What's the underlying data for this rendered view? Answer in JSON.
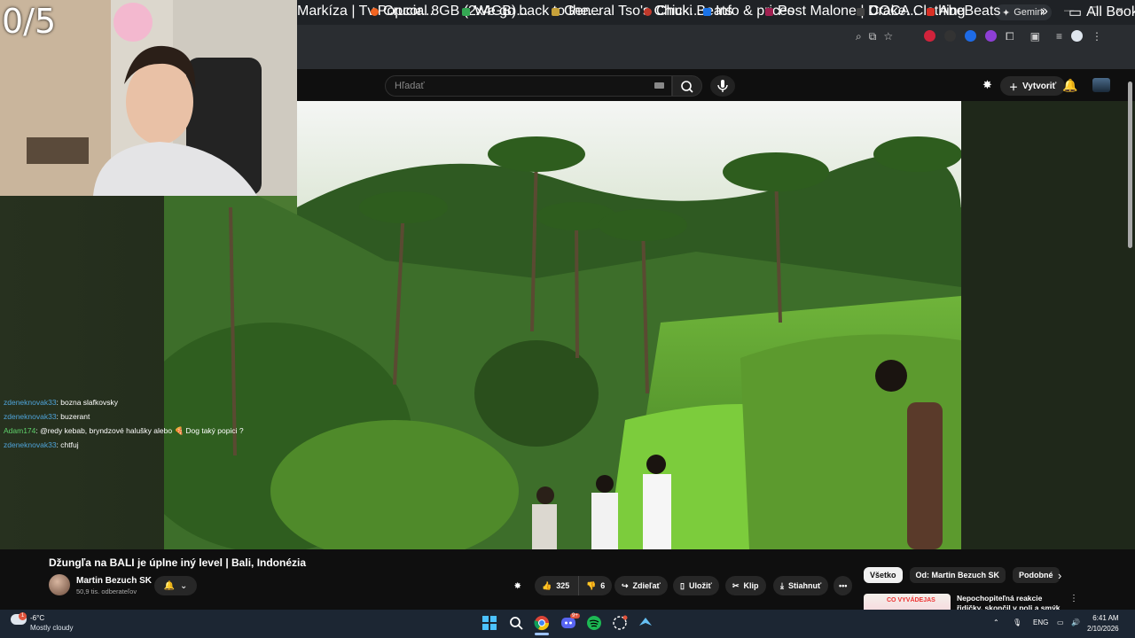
{
  "stream_overlay": {
    "counter": "0/5",
    "chat": [
      {
        "user": "zdeneknovak33",
        "message": ": bozna slafkovsky",
        "user_color": "#4ea3d9"
      },
      {
        "user": "zdeneknovak33",
        "message": ": buzerant",
        "user_color": "#4ea3d9"
      },
      {
        "user": "Adam174",
        "message": ": @redy kebab, bryndzové halušky alebo 🍕 Dog taký popici ?",
        "user_color": "#5fd16b"
      },
      {
        "user": "zdeneknovak33",
        "message": ": chtfuj",
        "user_color": "#4ea3d9"
      }
    ]
  },
  "browser": {
    "gemini_label": "Gemini",
    "bookmarks": [
      {
        "label": "Markíza | Tv.Popcor...",
        "color": "#3a7bd5"
      },
      {
        "label": "Crucial 8GB (2x4GB)...",
        "color": "#f26522"
      },
      {
        "label": "We go back to the...",
        "color": "#34a853"
      },
      {
        "label": "General Tso's Chick...",
        "color": "#c7a13a"
      },
      {
        "label": "Chuki Beats",
        "color": "#c0392b"
      },
      {
        "label": "Info & prices",
        "color": "#1a73e8"
      },
      {
        "label": "Post Malone | Drake...",
        "color": "#a02050"
      },
      {
        "label": "COCA Clothing",
        "color": "#222222"
      },
      {
        "label": "AbeBeats",
        "color": "#d93025"
      }
    ],
    "more_bookmarks": "»",
    "all_bookmarks": "All Bookmarks"
  },
  "youtube": {
    "search_placeholder": "Hľadať",
    "create_label": "Vytvoriť",
    "video_title": "Džungľa na BALI je úplne iný level | Bali, Indonézia",
    "channel_name": "Martin Bezuch SK",
    "subscribers": "50,9 tis. odberateľov",
    "likes": "325",
    "dislikes": "6",
    "share_label": "Zdieľať",
    "save_label": "Uložiť",
    "clip_label": "Klip",
    "download_label": "Stiahnuť",
    "more_label": "•••",
    "chips": [
      "Všetko",
      "Od: Martin Bezuch SK",
      "Podobné"
    ],
    "recommended": {
      "thumb_text": "CO VYVÁDEJAS",
      "title": "Nepochopiteľná reakcie řidičky, skončil v poli a smýk na ledov..."
    }
  },
  "taskbar": {
    "weather_badge": "1",
    "temperature": "-6°C",
    "condition": "Mostly cloudy",
    "language": "ENG",
    "time": "6:41 AM",
    "date": "2/10/2026",
    "discord_badge": "9+"
  }
}
